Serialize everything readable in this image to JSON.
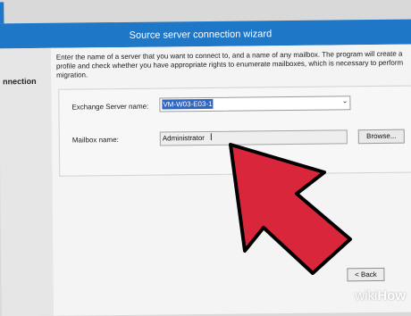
{
  "window": {
    "title": "Source server connection wizard"
  },
  "sidebar": {
    "step_label": "nnection"
  },
  "description": {
    "line1": "Enter the name of a server that you want to connect to, and a name of any mailbox. The program will create a",
    "line2": "profile and check whether you have appropriate rights to enumerate mailboxes, which is necessary to perform",
    "line3": "migration."
  },
  "form": {
    "server_label": "Exchange Server name:",
    "server_value": "VM-W03-E03-1",
    "mailbox_label": "Mailbox name:",
    "mailbox_value": "Administrator",
    "browse_label": "Browse..."
  },
  "footer": {
    "back_label": "< Back"
  },
  "overlay": {
    "arrow_color": "#d9263a",
    "brand_part1": "wiki",
    "brand_part2": "How"
  },
  "colors": {
    "title_bar": "#1f77c8",
    "selection": "#2f66c3"
  }
}
